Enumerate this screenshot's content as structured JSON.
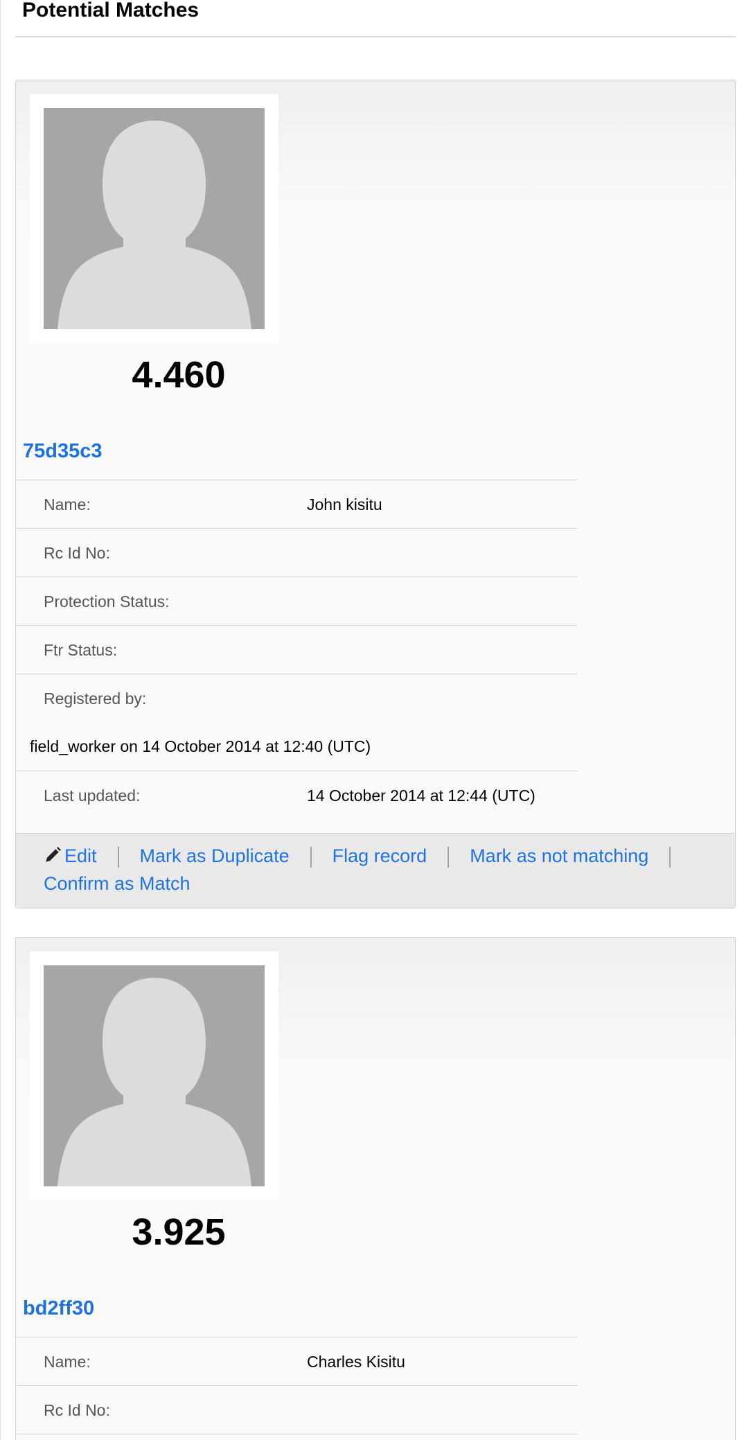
{
  "section": {
    "title": "Potential Matches"
  },
  "matches": [
    {
      "score": "4.460",
      "record_id": "75d35c3",
      "fields": {
        "name_label": "Name:",
        "name_value": "John kisitu",
        "rc_label": "Rc Id No:",
        "protection_label": "Protection Status:",
        "ftr_label": "Ftr Status:",
        "registered_label": "Registered by:",
        "registered_value": "field_worker on 14 October 2014 at 12:40 (UTC)",
        "updated_label": "Last updated:",
        "updated_value": "14 October 2014 at 12:44 (UTC)"
      },
      "actions": {
        "edit": "Edit",
        "duplicate": "Mark as Duplicate",
        "flag": "Flag record",
        "not_matching": "Mark as not matching",
        "confirm": "Confirm as Match"
      }
    },
    {
      "score": "3.925",
      "record_id": "bd2ff30",
      "fields": {
        "name_label": "Name:",
        "name_value": "Charles Kisitu",
        "rc_label": "Rc Id No:"
      }
    }
  ],
  "colors": {
    "link": "#1f73e0",
    "photo_background": "#a6a6a6",
    "silhouette": "#dcdcdc"
  },
  "icons": {
    "edit": "pencil-icon",
    "photo": "person-silhouette-icon"
  }
}
